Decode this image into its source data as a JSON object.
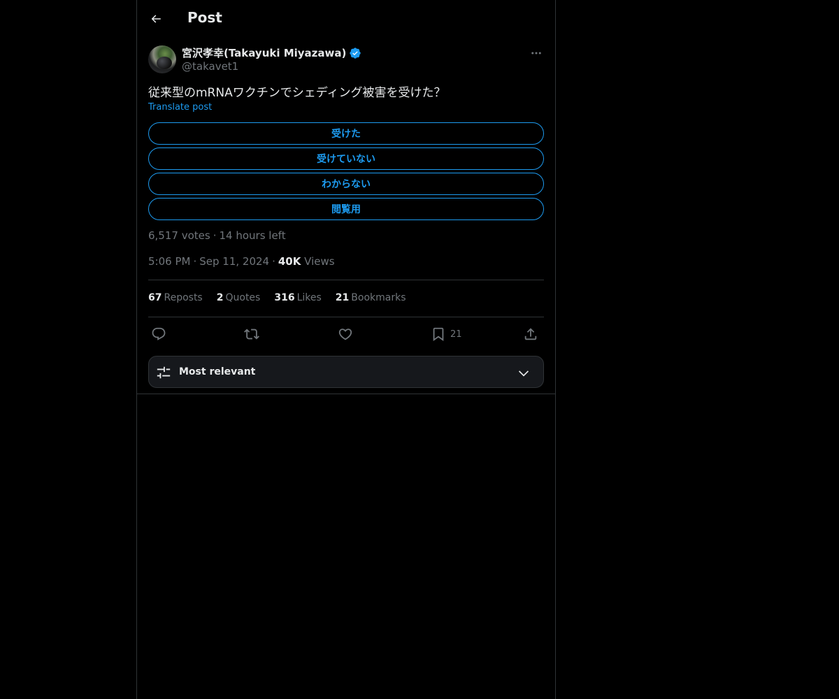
{
  "header": {
    "title": "Post"
  },
  "author": {
    "display_name": "宮沢孝幸(Takayuki Miyazawa)",
    "handle": "@takavet1"
  },
  "post": {
    "text": "従来型のmRNAワクチンでシェディング被害を受けた？",
    "translate_label": "Translate post"
  },
  "poll": {
    "options": [
      "受けた",
      "受けていない",
      "わからない",
      "閲覧用"
    ],
    "votes": "6,517 votes",
    "time_left": "14 hours left"
  },
  "meta": {
    "time": "5:06 PM",
    "date": "Sep 11, 2024",
    "views_count": "40K",
    "views_label": "Views"
  },
  "stats": {
    "reposts_count": "67",
    "reposts_label": "Reposts",
    "quotes_count": "2",
    "quotes_label": "Quotes",
    "likes_count": "316",
    "likes_label": "Likes",
    "bookmarks_count": "21",
    "bookmarks_label": "Bookmarks"
  },
  "actions": {
    "bookmark_count": "21"
  },
  "sort": {
    "label": "Most relevant"
  },
  "colors": {
    "accent": "#1d9bf0",
    "background": "#000000",
    "border": "#2f3336",
    "muted_text": "#71767b",
    "primary_text": "#e7e9ea"
  },
  "icons": [
    "back-arrow-icon",
    "verified-badge-icon",
    "more-icon",
    "reply-icon",
    "repost-icon",
    "like-icon",
    "bookmark-icon",
    "share-icon",
    "sliders-icon",
    "chevron-down-icon"
  ]
}
